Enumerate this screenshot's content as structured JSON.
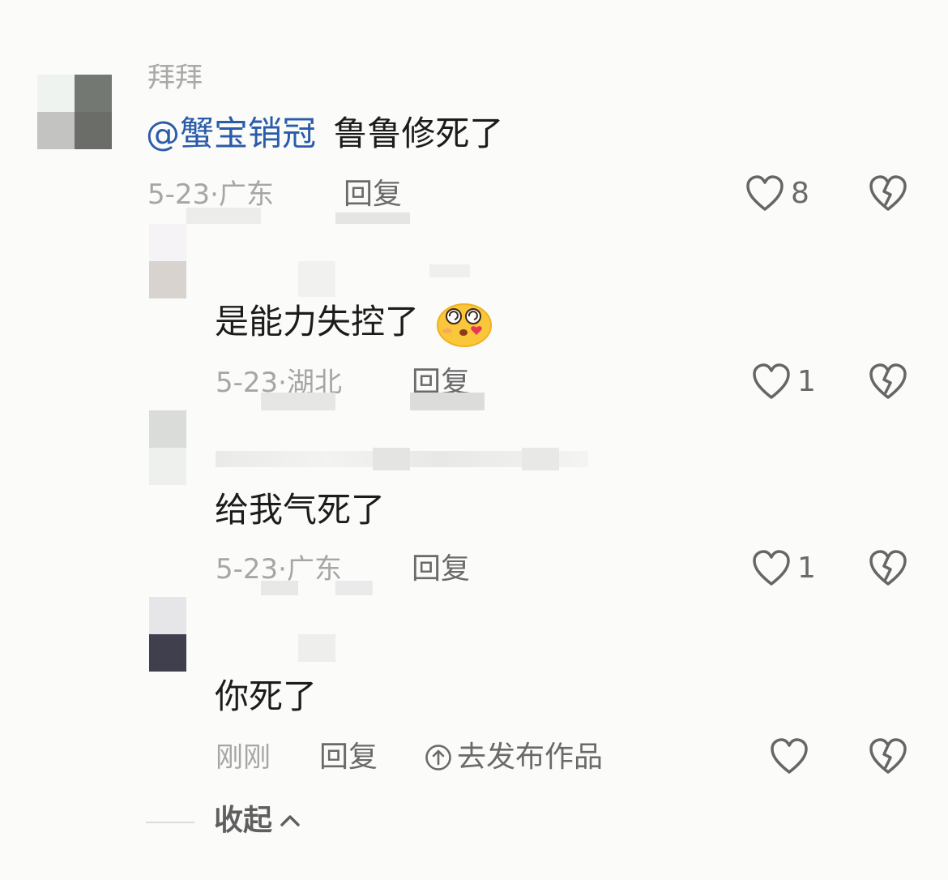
{
  "comments": [
    {
      "username": "拜拜",
      "mention": "@蟹宝销冠",
      "text": "鲁鲁修死了",
      "date": "5-23",
      "location": "广东",
      "reply_label": "回复",
      "likes": "8"
    },
    {
      "username": "",
      "text": "是能力失控了",
      "date": "5-23",
      "location": "湖北",
      "reply_label": "回复",
      "likes": "1"
    },
    {
      "username": "",
      "text": "给我气死了",
      "date": "5-23",
      "location": "广东",
      "reply_label": "回复",
      "likes": "1"
    },
    {
      "username": "",
      "text": "你死了",
      "time": "刚刚",
      "reply_label": "回复",
      "publish_label": "去发布作品",
      "likes": ""
    }
  ],
  "separator": "·",
  "collapse_label": "收起",
  "icons": {
    "like": "heart-outline-icon",
    "dislike": "broken-heart-icon",
    "publish": "arrow-up-circle-icon",
    "collapse": "chevron-up-icon",
    "emoji": "dizzy-blush-emoji-icon"
  },
  "colors": {
    "background": "#fbfbf9",
    "mention": "#2a5caa",
    "meta": "#a6a6a6",
    "action": "#6a6a6a"
  }
}
